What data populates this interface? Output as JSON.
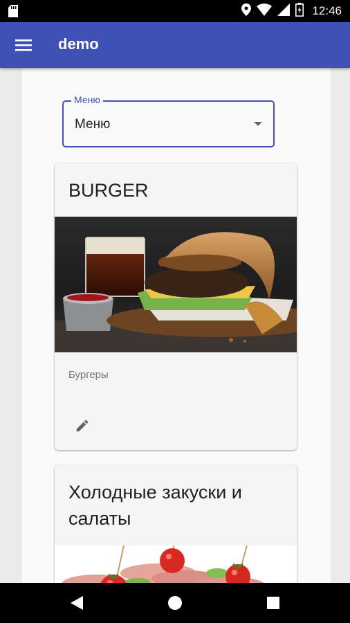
{
  "status_bar": {
    "time": "12:46",
    "icons": [
      "sd-card-icon",
      "location-icon",
      "wifi-icon",
      "signal-icon",
      "battery-icon"
    ]
  },
  "app_bar": {
    "title": "demo",
    "menu_icon": "hamburger-menu-icon"
  },
  "menu_select": {
    "label": "Меню",
    "value": "Меню",
    "accent": "#3f51b5"
  },
  "cards": [
    {
      "title": "BURGER",
      "subtitle": "Бургеры",
      "image": "burger-photo",
      "action_icon": "edit-icon"
    },
    {
      "title": "Холодные закуски и салаты",
      "image": "appetizer-photo"
    }
  ],
  "nav_bar": {
    "icons": [
      "back-icon",
      "home-icon",
      "recents-icon"
    ]
  },
  "colors": {
    "primary": "#3f51b5",
    "card_background": "#f5f5f5",
    "page_background": "#fafafa"
  }
}
